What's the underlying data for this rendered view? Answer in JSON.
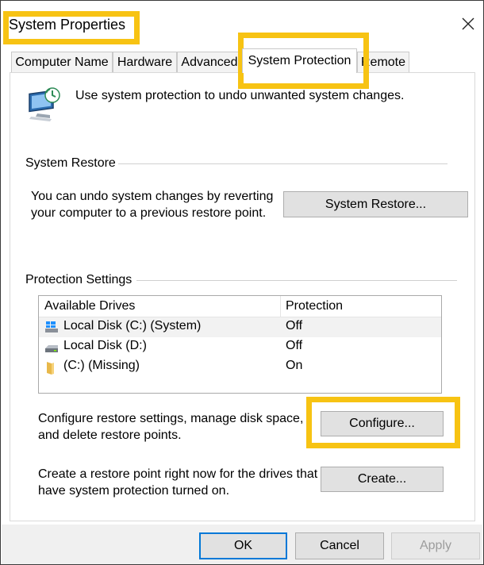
{
  "window": {
    "title": "System Properties"
  },
  "tabs": [
    {
      "label": "Computer Name"
    },
    {
      "label": "Hardware"
    },
    {
      "label": "Advanced"
    },
    {
      "label": "System Protection"
    },
    {
      "label": "Remote"
    }
  ],
  "header": {
    "description": "Use system protection to undo unwanted system changes.",
    "icon": "computer-shield-icon"
  },
  "system_restore": {
    "group_label": "System Restore",
    "line1": "You can undo system changes by reverting",
    "line2": "your computer to a previous restore point.",
    "button_label": "System Restore..."
  },
  "protection_settings": {
    "group_label": "Protection Settings",
    "columns": [
      "Available Drives",
      "Protection"
    ],
    "drives": [
      {
        "name": "Local Disk (C:) (System)",
        "protection": "Off",
        "icon": "windows-drive-icon"
      },
      {
        "name": "Local Disk (D:)",
        "protection": "Off",
        "icon": "disk-drive-icon"
      },
      {
        "name": "(C:) (Missing)",
        "protection": "On",
        "icon": "folder-icon"
      }
    ],
    "configure_line1": "Configure restore settings, manage disk space,",
    "configure_line2": "and delete restore points.",
    "configure_button": "Configure...",
    "create_line1": "Create a restore point right now for the drives that",
    "create_line2": "have system protection turned on.",
    "create_button": "Create..."
  },
  "footer": {
    "ok": "OK",
    "cancel": "Cancel",
    "apply": "Apply"
  },
  "colors": {
    "highlight": "#f7c313",
    "accent": "#0078d7"
  }
}
